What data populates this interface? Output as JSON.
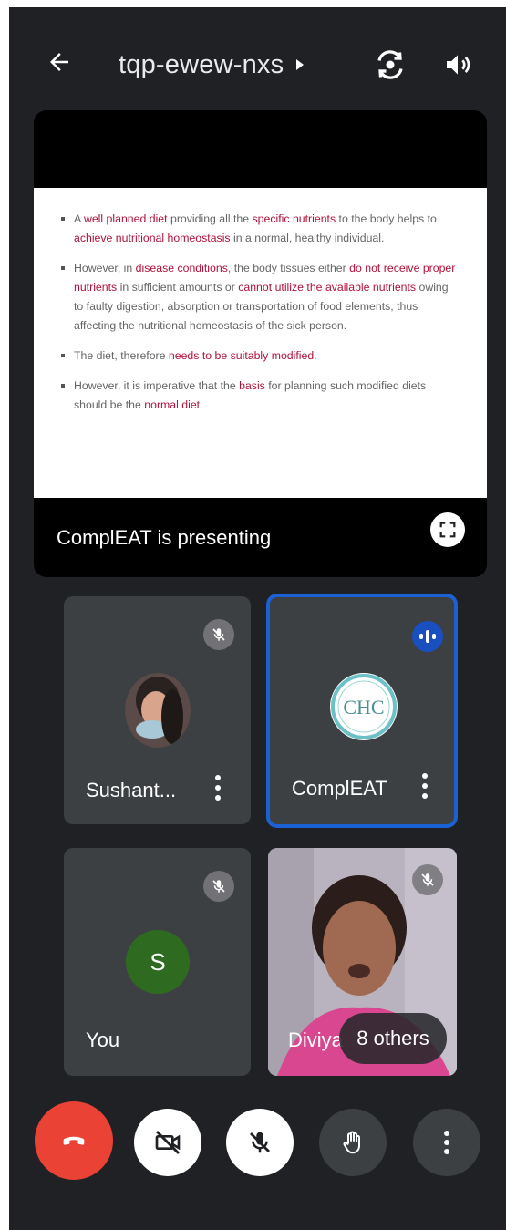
{
  "header": {
    "meeting_code": "tqp-ewew-nxs",
    "icons": [
      "back-arrow-icon",
      "caret-right-icon",
      "switch-camera-icon",
      "speaker-icon"
    ]
  },
  "presentation": {
    "presenting_label": "ComplEAT is presenting",
    "slide_bullets": [
      [
        {
          "t": "A ",
          "h": false
        },
        {
          "t": "well planned diet",
          "h": true
        },
        {
          "t": " providing all the ",
          "h": false
        },
        {
          "t": "specific nutrients",
          "h": true
        },
        {
          "t": " to the body helps to ",
          "h": false
        },
        {
          "t": "achieve nutritional homeostasis",
          "h": true
        },
        {
          "t": " in a normal, healthy individual.",
          "h": false
        }
      ],
      [
        {
          "t": "However, in ",
          "h": false
        },
        {
          "t": "disease conditions",
          "h": true
        },
        {
          "t": ", the body tissues either ",
          "h": false
        },
        {
          "t": "do not receive proper nutrients",
          "h": true
        },
        {
          "t": " in sufficient amounts or ",
          "h": false
        },
        {
          "t": "cannot utilize the available nutrients",
          "h": true
        },
        {
          "t": " owing to faulty digestion, absorption or transportation of food elements, thus affecting the nutritional homeostasis of the sick person.",
          "h": false
        }
      ],
      [
        {
          "t": "The diet, therefore ",
          "h": false
        },
        {
          "t": "needs to be suitably modified.",
          "h": true
        }
      ],
      [
        {
          "t": "However, it is imperative that the ",
          "h": false
        },
        {
          "t": "basis",
          "h": true
        },
        {
          "t": " for planning such modified diets should be the ",
          "h": false
        },
        {
          "t": "normal diet.",
          "h": true
        }
      ]
    ]
  },
  "participants": [
    {
      "name": "Sushant...",
      "muted": true,
      "avatar": "photo"
    },
    {
      "name": "ComplEAT",
      "muted": false,
      "speaking": true,
      "avatar": "logo",
      "logo_text": "CHC"
    },
    {
      "name": "You",
      "muted": true,
      "avatar": "letter",
      "initial": "S"
    },
    {
      "name": "Diviya",
      "muted": true,
      "avatar": "video"
    }
  ],
  "others_label": "8 others",
  "controls": [
    "end-call",
    "camera-off",
    "mic-off",
    "raise-hand",
    "more-options"
  ],
  "colors": {
    "background": "#202124",
    "tile": "#3c4043",
    "active_border": "#1a61d4",
    "end_call": "#ea4335",
    "slide_highlight": "#b0123b",
    "you_avatar": "#2e6b21"
  }
}
